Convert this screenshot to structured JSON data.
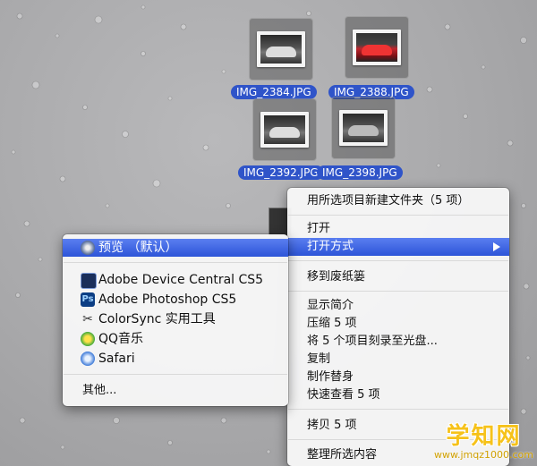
{
  "desktop": {
    "files": [
      {
        "name": "IMG_2384.JPG"
      },
      {
        "name": "IMG_2388.JPG"
      },
      {
        "name": "IMG_2392.JPG"
      },
      {
        "name": "IMG_2398.JPG"
      }
    ]
  },
  "context_menu": {
    "items": [
      {
        "label": "用所选项目新建文件夹（5 项）"
      },
      {
        "label": "打开"
      },
      {
        "label": "打开方式",
        "highlighted": true,
        "has_submenu": true
      },
      {
        "label": "移到废纸篓"
      },
      {
        "label": "显示简介"
      },
      {
        "label": "压缩 5 项"
      },
      {
        "label": "将 5 个项目刻录至光盘..."
      },
      {
        "label": "复制"
      },
      {
        "label": "制作替身"
      },
      {
        "label": "快速查看 5 项"
      },
      {
        "label": "拷贝 5 项"
      },
      {
        "label": "整理所选内容"
      }
    ]
  },
  "open_with_submenu": {
    "items": [
      {
        "label": "预览 （默认）",
        "icon": "preview-icon",
        "highlighted": true
      },
      {
        "label": "Adobe Device Central CS5",
        "icon": "adobe-device-central-icon"
      },
      {
        "label": "Adobe Photoshop CS5",
        "icon": "photoshop-icon"
      },
      {
        "label": "ColorSync 实用工具",
        "icon": "colorsync-icon"
      },
      {
        "label": "QQ音乐",
        "icon": "qq-music-icon"
      },
      {
        "label": "Safari",
        "icon": "safari-icon"
      },
      {
        "label": "其他..."
      }
    ]
  },
  "watermark": {
    "main": "学知网",
    "sub": "www.jmqz1000.com"
  },
  "colors": {
    "selection": "#2f54c9",
    "highlight": "#3a62e0",
    "watermark": "#f6c21a"
  }
}
